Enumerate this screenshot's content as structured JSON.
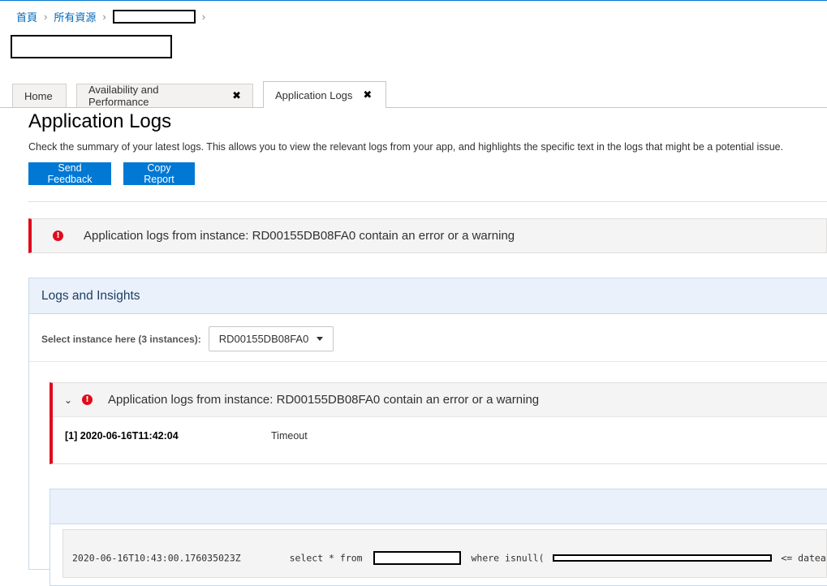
{
  "breadcrumb": {
    "items": [
      {
        "label": "首頁"
      },
      {
        "label": "所有資源"
      }
    ]
  },
  "tabs": [
    {
      "label": "Home",
      "closable": false,
      "active": false
    },
    {
      "label": "Availability and Performance",
      "closable": true,
      "active": false
    },
    {
      "label": "Application Logs",
      "closable": true,
      "active": true
    }
  ],
  "tab_close_glyph": "✖",
  "page": {
    "title": "Application Logs",
    "description": "Check the summary of your latest logs. This allows you to view the relevant logs from your app, and highlights the specific text in the logs that might be a potential issue."
  },
  "buttons": {
    "send_feedback": "Send Feedback",
    "copy_report": "Copy Report"
  },
  "alert": {
    "icon": "error-icon",
    "text": "Application logs from instance: RD00155DB08FA0 contain an error or a warning",
    "color": "#e00b1c"
  },
  "panel": {
    "title": "Logs and Insights",
    "select_label": "Select instance here (3 instances):",
    "selected_instance": "RD00155DB08FA0"
  },
  "insight": {
    "title": "Application logs from instance: RD00155DB08FA0 contain an error or a warning",
    "row_key": "[1] 2020-06-16T11:42:04",
    "row_value": "Timeout"
  },
  "log": {
    "timestamp": "2020-06-16T10:43:00.176035023Z",
    "part1": "select * from",
    "part2": "where isnull(",
    "part3": "<= dateadd"
  },
  "colors": {
    "accent": "#0078d4",
    "error": "#e00b1c",
    "panel_header": "#eaf1fa"
  }
}
